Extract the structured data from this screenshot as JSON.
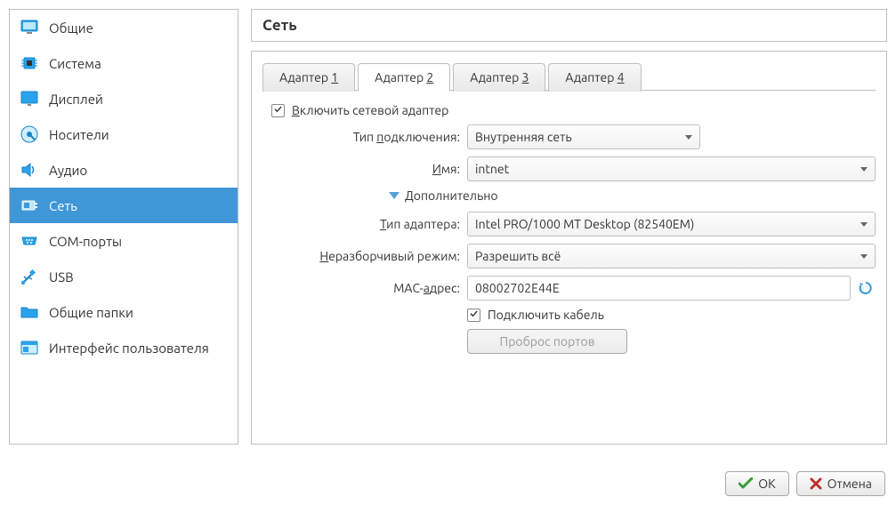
{
  "sidebar": {
    "items": [
      {
        "id": "general",
        "label": "Общие"
      },
      {
        "id": "system",
        "label": "Система"
      },
      {
        "id": "display",
        "label": "Дисплей"
      },
      {
        "id": "storage",
        "label": "Носители"
      },
      {
        "id": "audio",
        "label": "Аудио"
      },
      {
        "id": "network",
        "label": "Сеть"
      },
      {
        "id": "serial",
        "label": "COM-порты"
      },
      {
        "id": "usb",
        "label": "USB"
      },
      {
        "id": "shared",
        "label": "Общие папки"
      },
      {
        "id": "ui",
        "label": "Интерфейс пользователя"
      }
    ]
  },
  "panel": {
    "title": "Сеть"
  },
  "tabs": {
    "items": [
      {
        "prefix": "Адаптер ",
        "num": "1"
      },
      {
        "prefix": "Адаптер ",
        "num": "2"
      },
      {
        "prefix": "Адаптер ",
        "num": "3"
      },
      {
        "prefix": "Адаптер ",
        "num": "4"
      }
    ]
  },
  "form": {
    "enable_adapter_prefix": "В",
    "enable_adapter_rest": "ключить сетевой адаптер",
    "attached_label_prefix": "Тип ",
    "attached_label_u": "п",
    "attached_label_rest": "одключения:",
    "attached_value": "Внутренняя сеть",
    "name_label_u": "И",
    "name_label_rest": "мя:",
    "name_value": "intnet",
    "advanced_u": "Д",
    "advanced_rest": "ополнительно",
    "adapter_type_label_u": "Т",
    "adapter_type_label_rest": "ип адаптера:",
    "adapter_type_value": "Intel PRO/1000 MT Desktop (82540EM)",
    "promisc_label_u": "Н",
    "promisc_label_rest": "еразборчивый режим:",
    "promisc_value": "Разрешить всё",
    "mac_label_prefix": "MAC-",
    "mac_label_u": "а",
    "mac_label_rest": "дрес:",
    "mac_value": "08002702E44E",
    "cable_label": "Подключить кабель",
    "port_forward_label": "Проброс портов"
  },
  "buttons": {
    "ok": "OK",
    "cancel": "Отмена"
  }
}
